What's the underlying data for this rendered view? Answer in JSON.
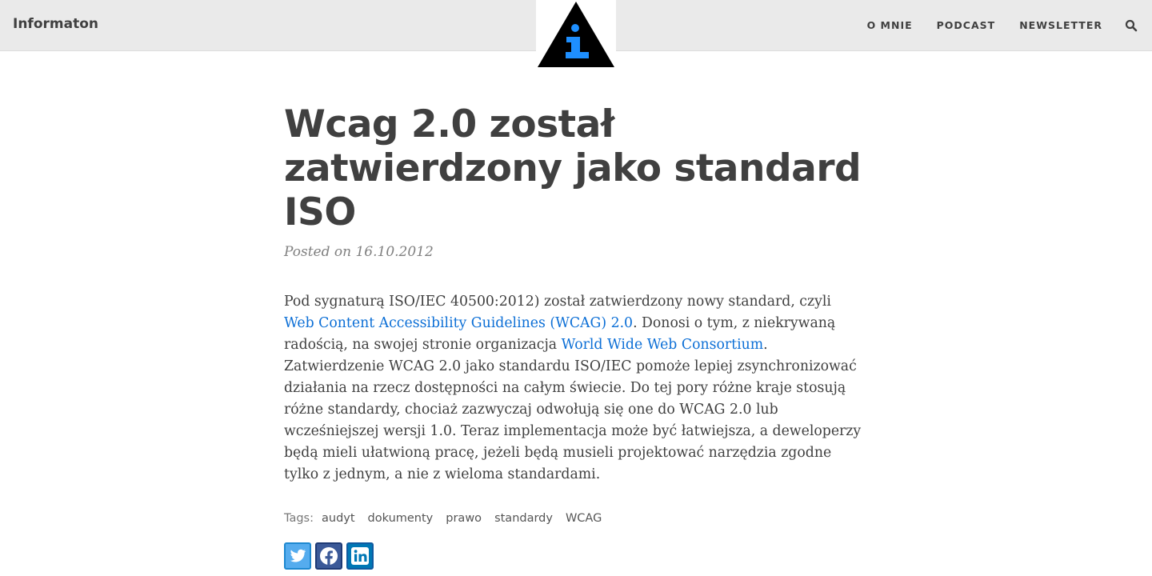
{
  "brand": "Informaton",
  "nav": {
    "items": [
      {
        "label": "O MNIE"
      },
      {
        "label": "PODCAST"
      },
      {
        "label": "NEWSLETTER"
      }
    ],
    "search_icon": "search-icon"
  },
  "logo": {
    "icon": "info-triangle-logo",
    "colors": {
      "triangle": "#000000",
      "letter": "#1e8fff"
    }
  },
  "post": {
    "title": "Wcag 2.0 został zatwierdzony jako standard ISO",
    "meta": "Posted on 16.10.2012",
    "body": {
      "p1": "Pod sygnaturą ISO/IEC 40500:2012) został zatwierdzony nowy standard, czyli ",
      "link1": "Web Content Accessibility Guidelines (WCAG) 2.0",
      "p2": ". Donosi o tym, z niekrywaną radością, na swojej stronie organizacja ",
      "link2": "World Wide Web Consortium",
      "p3": ". Zatwierdzenie WCAG 2.0 jako standardu ISO/IEC pomoże lepiej zsynchronizować działania na rzecz dostępności na całym świecie. Do tej pory różne kraje stosują różne standardy, chociaż zazwyczaj odwołują się one do WCAG 2.0 lub wcześniejszej wersji 1.0. Teraz implementacja może być łatwiejsza, a deweloperzy będą mieli ułatwioną pracę, jeżeli będą musieli projektować narzędzia zgodne tylko z jednym, a nie z wieloma standardami."
    },
    "tags_label": "Tags:",
    "tags": [
      "audyt",
      "dokumenty",
      "prawo",
      "standardy",
      "WCAG"
    ],
    "share": [
      {
        "icon": "twitter-icon",
        "color": "#55acee"
      },
      {
        "icon": "facebook-icon",
        "color": "#3b5998"
      },
      {
        "icon": "linkedin-icon",
        "color": "#0077b5"
      }
    ]
  },
  "colors": {
    "link": "#0c6fd6",
    "navbar_bg": "#eaeaea",
    "text": "#404040"
  }
}
